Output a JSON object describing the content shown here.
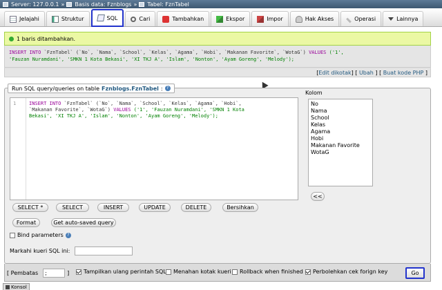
{
  "breadcrumb": {
    "server": "Server: 127.0.0.1",
    "database": "Basis data: Fznblogs",
    "table": "Tabel: FznTabel",
    "separator": "»"
  },
  "tabs": [
    {
      "label": "Jelajahi",
      "icon": "browse-icon"
    },
    {
      "label": "Struktur",
      "icon": "structure-icon"
    },
    {
      "label": "SQL",
      "icon": "sql-icon",
      "active": true
    },
    {
      "label": "Cari",
      "icon": "search-icon"
    },
    {
      "label": "Tambahkan",
      "icon": "insert-icon"
    },
    {
      "label": "Ekspor",
      "icon": "export-icon"
    },
    {
      "label": "Impor",
      "icon": "import-icon"
    },
    {
      "label": "Hak Akses",
      "icon": "privileges-icon"
    },
    {
      "label": "Operasi",
      "icon": "operations-icon"
    },
    {
      "label": "Lainnya",
      "icon": "chevron-down-icon"
    }
  ],
  "message": {
    "success_text": "1 baris ditambahkan."
  },
  "executed_sql": {
    "line1_kw": "INSERT INTO ",
    "line1_rest": "`FznTabel` (`No`, `Nama`, `School`, `Kelas`, `Agama`, `Hobi`, `Makanan Favorite`, `WotaG`) ",
    "line1_kw2": "VALUES ",
    "line1_str": "('1',",
    "line2": "'Fauzan Nuramdani', 'SMKN 1 Kota Bekasi', 'XI TKJ A', 'Islam', 'Nonton', 'Ayam Goreng', 'Melody');"
  },
  "sql_links": {
    "edit_inline": "Edit dikotak",
    "edit": "Ubah",
    "create_php": "Buat kode PHP"
  },
  "query_panel": {
    "legend_prefix": "Run SQL query/queries on table ",
    "legend_table": "Fznblogs.FznTabel",
    "legend_suffix": ":",
    "line_number": "1",
    "editor_text": "INSERT INTO `FznTabel` (`No`, `Nama`, `School`, `Kelas`, `Agama`, `Hobi`,\n`Makanan Favorite`, `WotaG`) VALUES ('1', 'Fauzan Nuramdani', 'SMKN 1 Kota\nBekasi', 'XI TKJ A', 'Islam', 'Nonton', 'Ayam Goreng', 'Melody');"
  },
  "columns": {
    "label": "Kolom",
    "items": [
      "No",
      "Nama",
      "School",
      "Kelas",
      "Agama",
      "Hobi",
      "Makanan Favorite",
      "WotaG"
    ],
    "insert_button": "<<"
  },
  "buttons": {
    "select_star": "SELECT *",
    "select": "SELECT",
    "insert": "INSERT",
    "update": "UPDATE",
    "delete": "DELETE",
    "clear": "Bersihkan",
    "format": "Format",
    "autosaved": "Get auto-saved query"
  },
  "options": {
    "bind_parameters": "Bind parameters",
    "bookmark_label": "Markahi kueri SQL ini:",
    "bookmark_value": ""
  },
  "footer": {
    "delimiter_open": "[ Pembatas",
    "delimiter_value": ";",
    "delimiter_close": "]",
    "show_again": "Tampilkan ulang perintah SQL",
    "retain_box": "Menahan kotak kueri",
    "rollback": "Rollback when finished",
    "foreign_key": "Perbolehkan cek forign key",
    "go": "Go"
  },
  "console": {
    "label": "Konsol"
  }
}
